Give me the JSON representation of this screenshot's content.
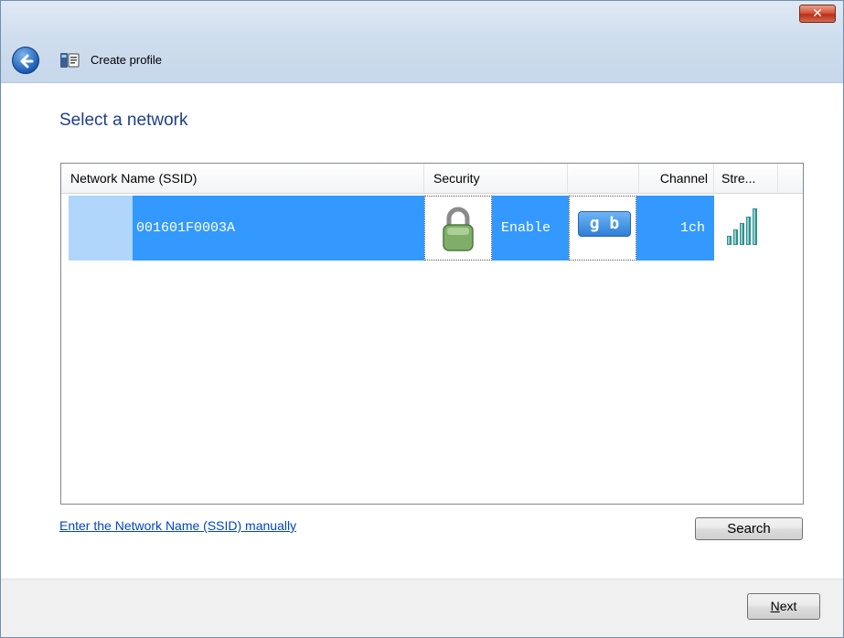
{
  "window": {
    "title": "Create profile",
    "close_label": "✕"
  },
  "page": {
    "heading": "Select a network"
  },
  "network_list": {
    "columns": [
      {
        "label": "Network Name (SSID)"
      },
      {
        "label": "Security"
      },
      {
        "label": ""
      },
      {
        "label": "Channel"
      },
      {
        "label": "Stre..."
      }
    ],
    "rows": [
      {
        "ssid": "001601F0003A",
        "security": "Enable",
        "mode_badge": "g b",
        "channel": "1ch",
        "icons": {
          "lock": "padlock-icon",
          "mode": "gb-mode-icon",
          "signal": "signal-strength-icon"
        }
      }
    ]
  },
  "actions": {
    "manual_link": "Enter the Network Name (SSID) manually",
    "search_label": "Search",
    "next_accel": "N",
    "next_rest": "ext"
  },
  "colors": {
    "selection": "#3399ff",
    "selection_light": "#b0d6fb",
    "heading": "#1e3f8a",
    "link": "#0044cc"
  }
}
